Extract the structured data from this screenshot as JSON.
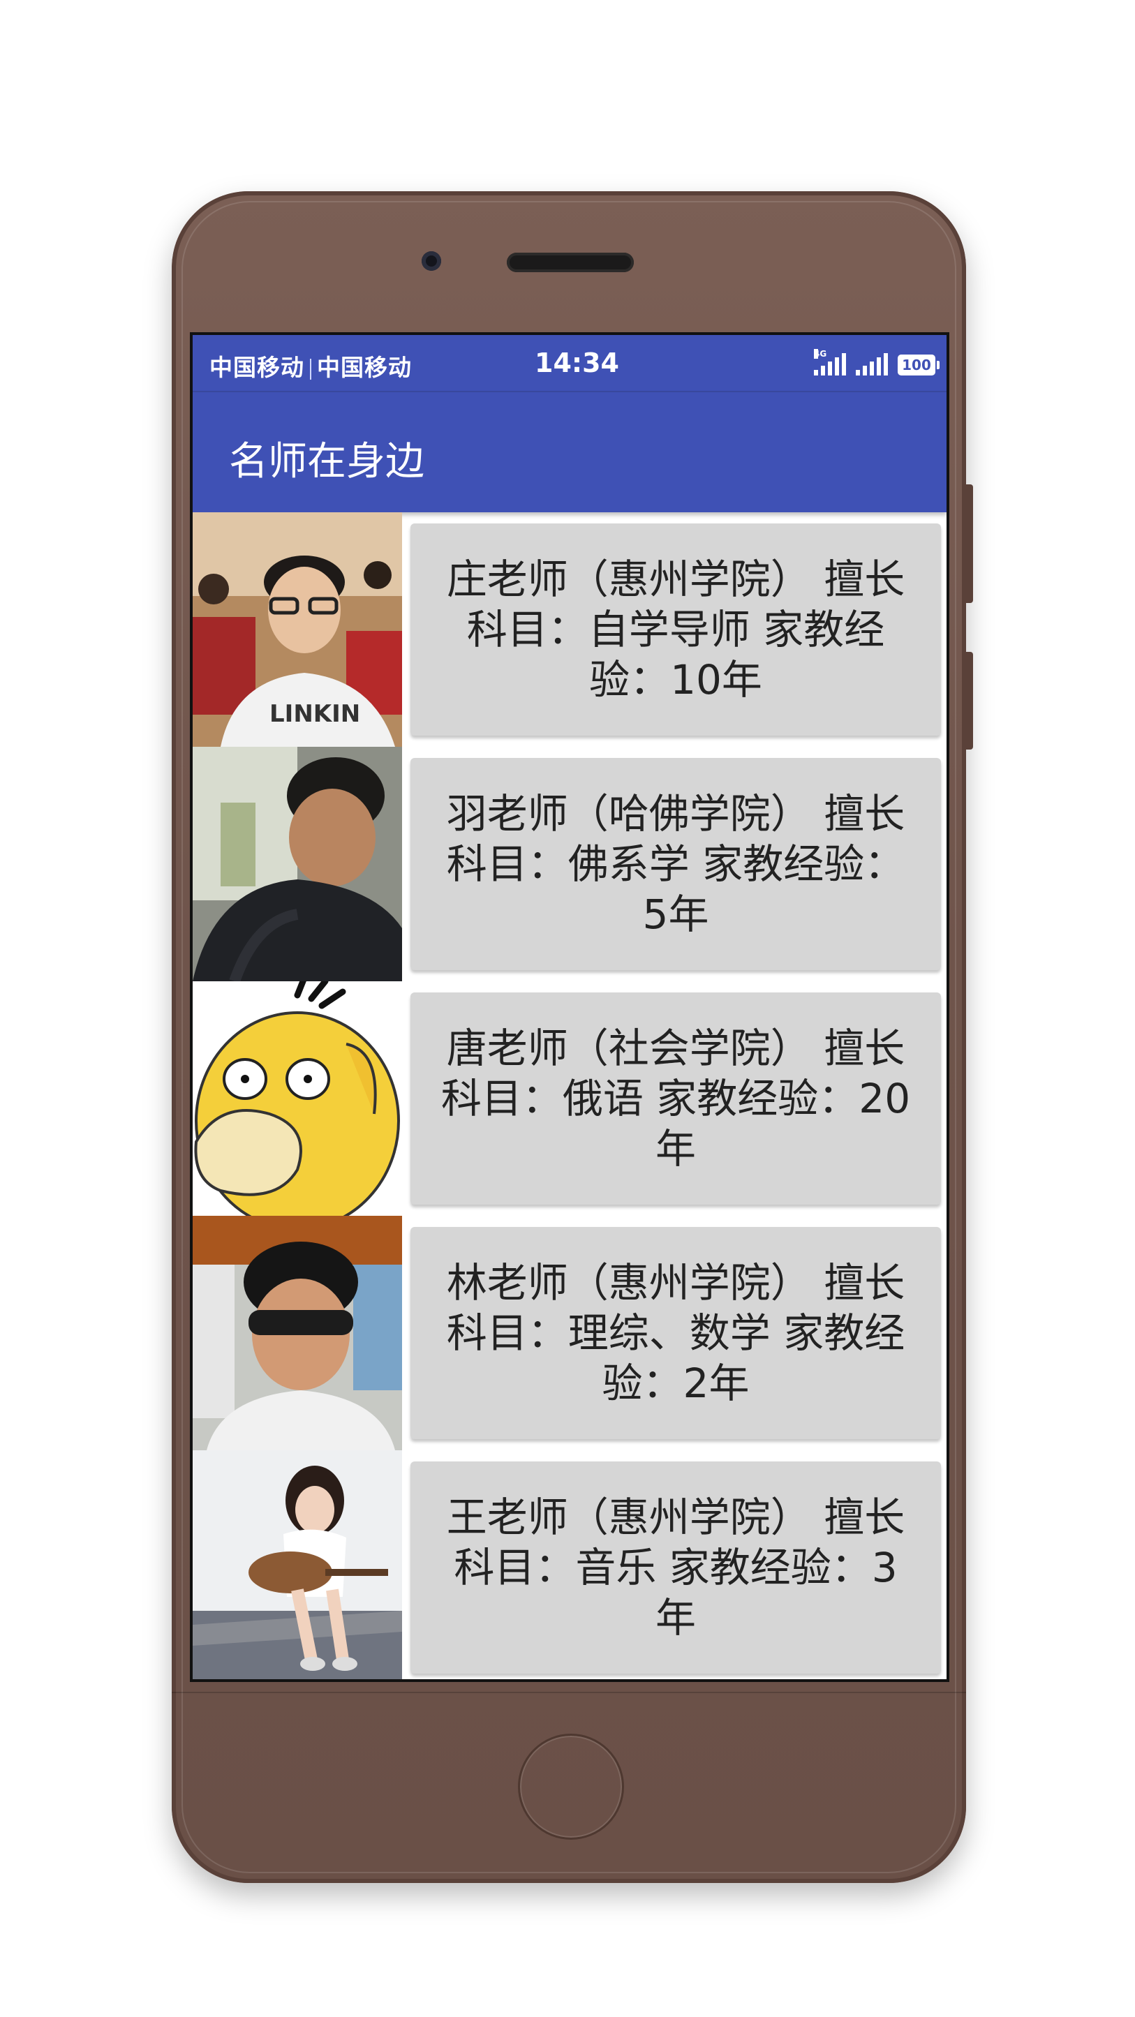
{
  "status_bar": {
    "carrier_1": "中国移动",
    "carrier_2": "中国移动",
    "time": "14:34",
    "network_type": "4G",
    "battery": "100"
  },
  "app_bar": {
    "title": "名师在身边"
  },
  "teachers": [
    {
      "description": "庄老师（惠州学院） 擅长科目：自学导师 家教经验：10年",
      "avatar": "photo-young-man-glasses"
    },
    {
      "description": "羽老师（哈佛学院） 擅长科目：佛系学 家教经验：5年",
      "avatar": "photo-young-man-looking-down"
    },
    {
      "description": "唐老师（社会学院） 擅长科目：俄语 家教经验：20年",
      "avatar": "cartoon-yellow-duck"
    },
    {
      "description": "林老师（惠州学院） 擅长科目：理综、数学 家教经验：2年",
      "avatar": "photo-young-man-sunglasses"
    },
    {
      "description": "王老师（惠州学院） 擅长科目：音乐 家教经验：3年",
      "avatar": "photo-girl-with-guitar"
    }
  ],
  "colors": {
    "primary": "#3f51b5",
    "card": "#d6d6d6",
    "phone_body": "#6f544b"
  }
}
